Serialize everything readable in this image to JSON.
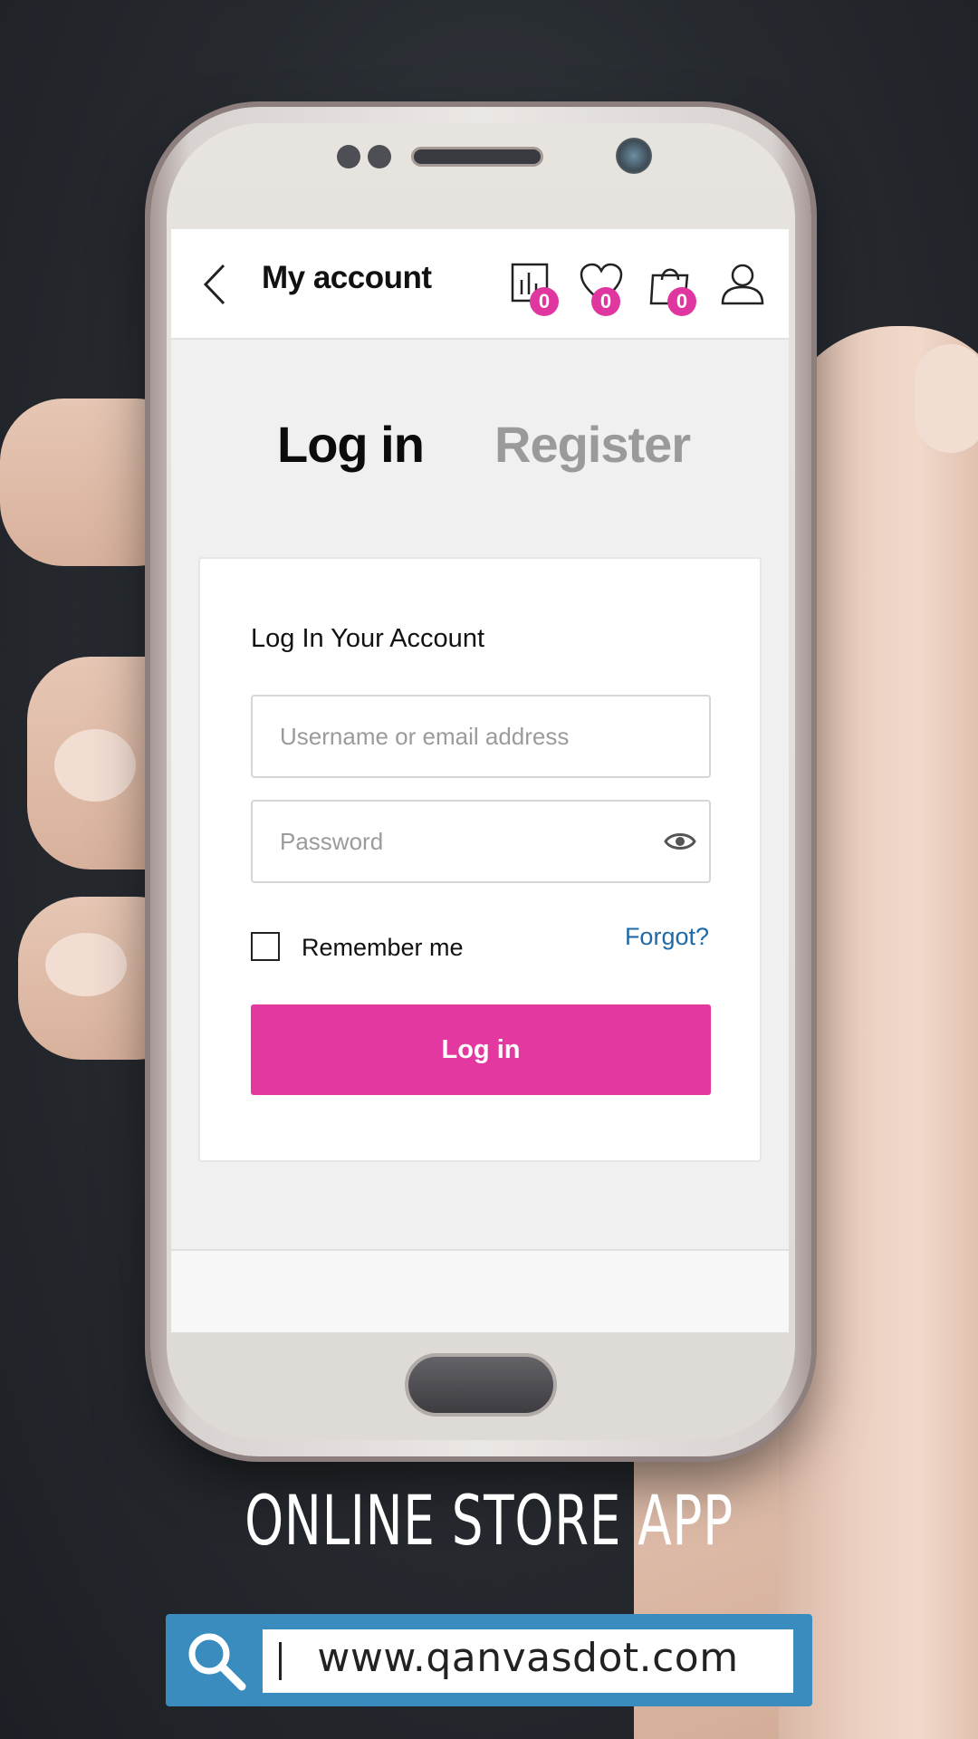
{
  "header": {
    "title": "My account",
    "icons": [
      {
        "name": "compare-icon",
        "badge": "0"
      },
      {
        "name": "heart-icon",
        "badge": "0"
      },
      {
        "name": "shopping-bag-icon",
        "badge": "0"
      },
      {
        "name": "user-icon"
      }
    ]
  },
  "tabs": {
    "login": "Log in",
    "register": "Register"
  },
  "login_card": {
    "title": "Log In Your Account",
    "username_placeholder": "Username or email address",
    "password_placeholder": "Password",
    "remember_label": "Remember me",
    "forgot_label": "Forgot?",
    "submit_label": "Log in"
  },
  "promo": {
    "title": "ONLINE STORE APP",
    "url": "www.qanvasdot.com"
  },
  "colors": {
    "accent": "#e2389f",
    "link": "#1e6aa8",
    "search_bar": "#3a8bbe"
  }
}
